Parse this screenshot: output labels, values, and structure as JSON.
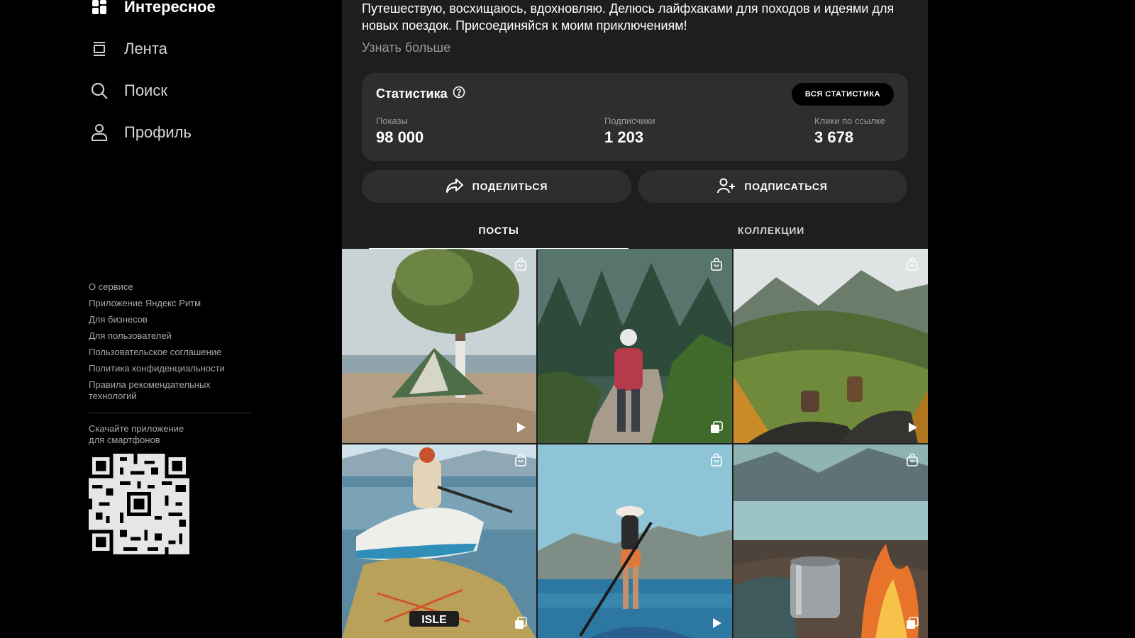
{
  "sidebar": {
    "nav": [
      {
        "label": "Интересное",
        "icon": "grid-icon",
        "active": true
      },
      {
        "label": "Лента",
        "icon": "feed-icon"
      },
      {
        "label": "Поиск",
        "icon": "search-icon"
      },
      {
        "label": "Профиль",
        "icon": "profile-icon"
      }
    ],
    "links": [
      "О сервисе",
      "Приложение Яндекс Ритм",
      "Для бизнесов",
      "Для пользователей",
      "Пользовательское соглашение",
      "Политика конфиденциальности",
      "Правила рекомендательных технологий"
    ],
    "app_text": "Скачайте приложение\nдля смартфонов"
  },
  "profile": {
    "bio": "Путешествую, восхищаюсь, вдохновляю. Делюсь лайфхаками для походов и идеями для новых поездок. Присоединяйся к моим приключениям!",
    "more": "Узнать больше"
  },
  "stats": {
    "title": "Статистика",
    "all_button": "ВСЯ СТАТИСТИКА",
    "items": [
      {
        "label": "Показы",
        "value": "98 000"
      },
      {
        "label": "Подписчики",
        "value": "1 203"
      },
      {
        "label": "Клики по ссылке",
        "value": "3 678"
      }
    ]
  },
  "actions": {
    "share": "ПОДЕЛИТЬСЯ",
    "subscribe": "ПОДПИСАТЬСЯ"
  },
  "tabs": [
    {
      "label": "ПОСТЫ",
      "active": true
    },
    {
      "label": "КОЛЛЕКЦИИ"
    }
  ],
  "posts": [
    {
      "scene": "tent-by-lake",
      "badge": "play-icon"
    },
    {
      "scene": "hiker-in-forest",
      "badge": "gallery-icon"
    },
    {
      "scene": "mountain-ridge-tent-view",
      "badge": "play-icon"
    },
    {
      "scene": "paddleboard-kneeling",
      "badge": "gallery-icon"
    },
    {
      "scene": "woman-on-sup",
      "badge": "play-icon"
    },
    {
      "scene": "campfire-mug",
      "badge": "gallery-icon"
    }
  ]
}
